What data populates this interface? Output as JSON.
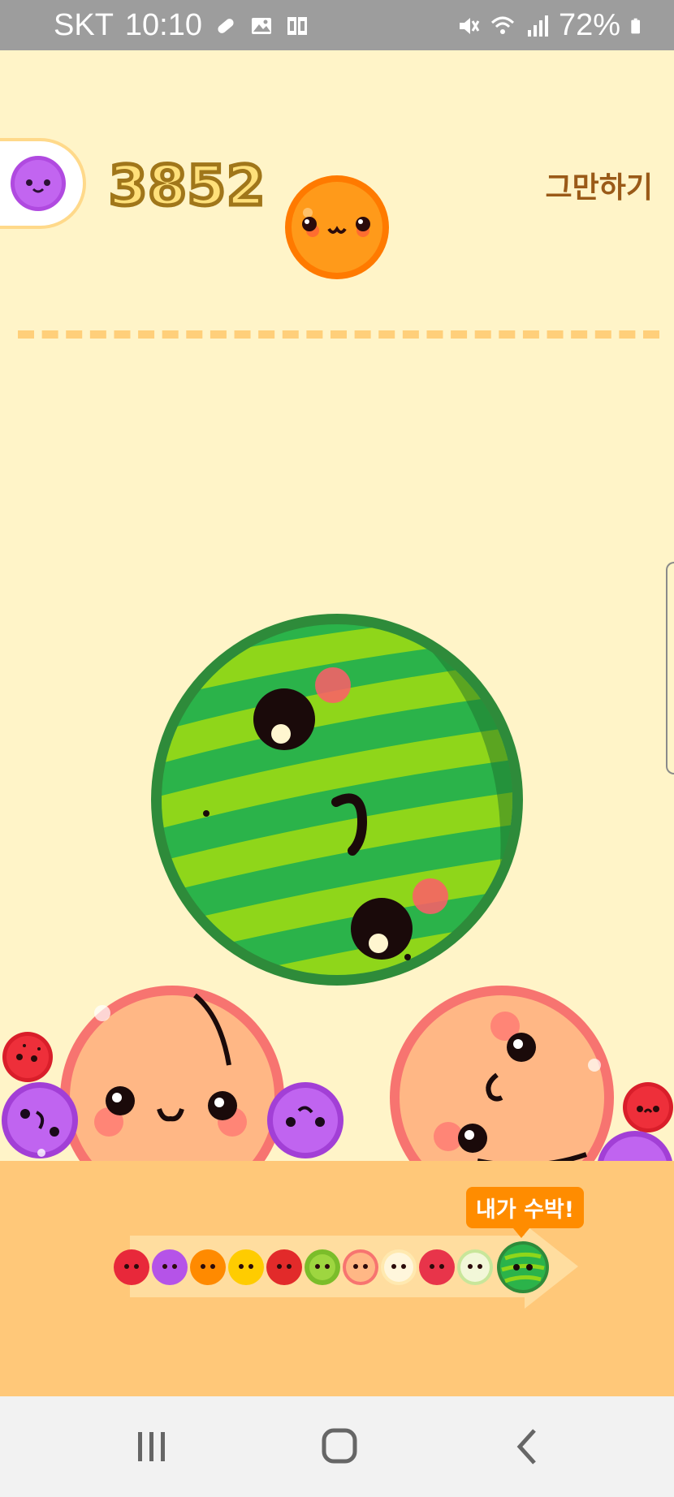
{
  "status_bar": {
    "carrier": "SKT",
    "time": "10:10",
    "battery": "72%",
    "icons": [
      "pill-icon",
      "image-icon",
      "cast-icon",
      "mute-vibrate-icon",
      "wifi-icon",
      "signal-icon",
      "battery-icon"
    ]
  },
  "game": {
    "score": "3852",
    "quit_label": "그만하기",
    "next_fruit": "grape",
    "current_drop_fruit": "orange",
    "tooltip": "내가 수박!",
    "evolution_chain": [
      "cherry",
      "grape",
      "orange",
      "lemon",
      "apple",
      "kiwi",
      "peach",
      "pear",
      "tomato",
      "melon",
      "watermelon"
    ]
  },
  "colors": {
    "background": "#fff4c8",
    "ground": "#ffc879",
    "dash": "#ffcf7a",
    "score_fill": "#ffe07a",
    "score_stroke": "#a0761a",
    "quit": "#9a5a18",
    "tooltip": "#ff8c00"
  },
  "nav_bar": {
    "buttons": [
      "recents-icon",
      "home-icon",
      "back-icon"
    ]
  }
}
